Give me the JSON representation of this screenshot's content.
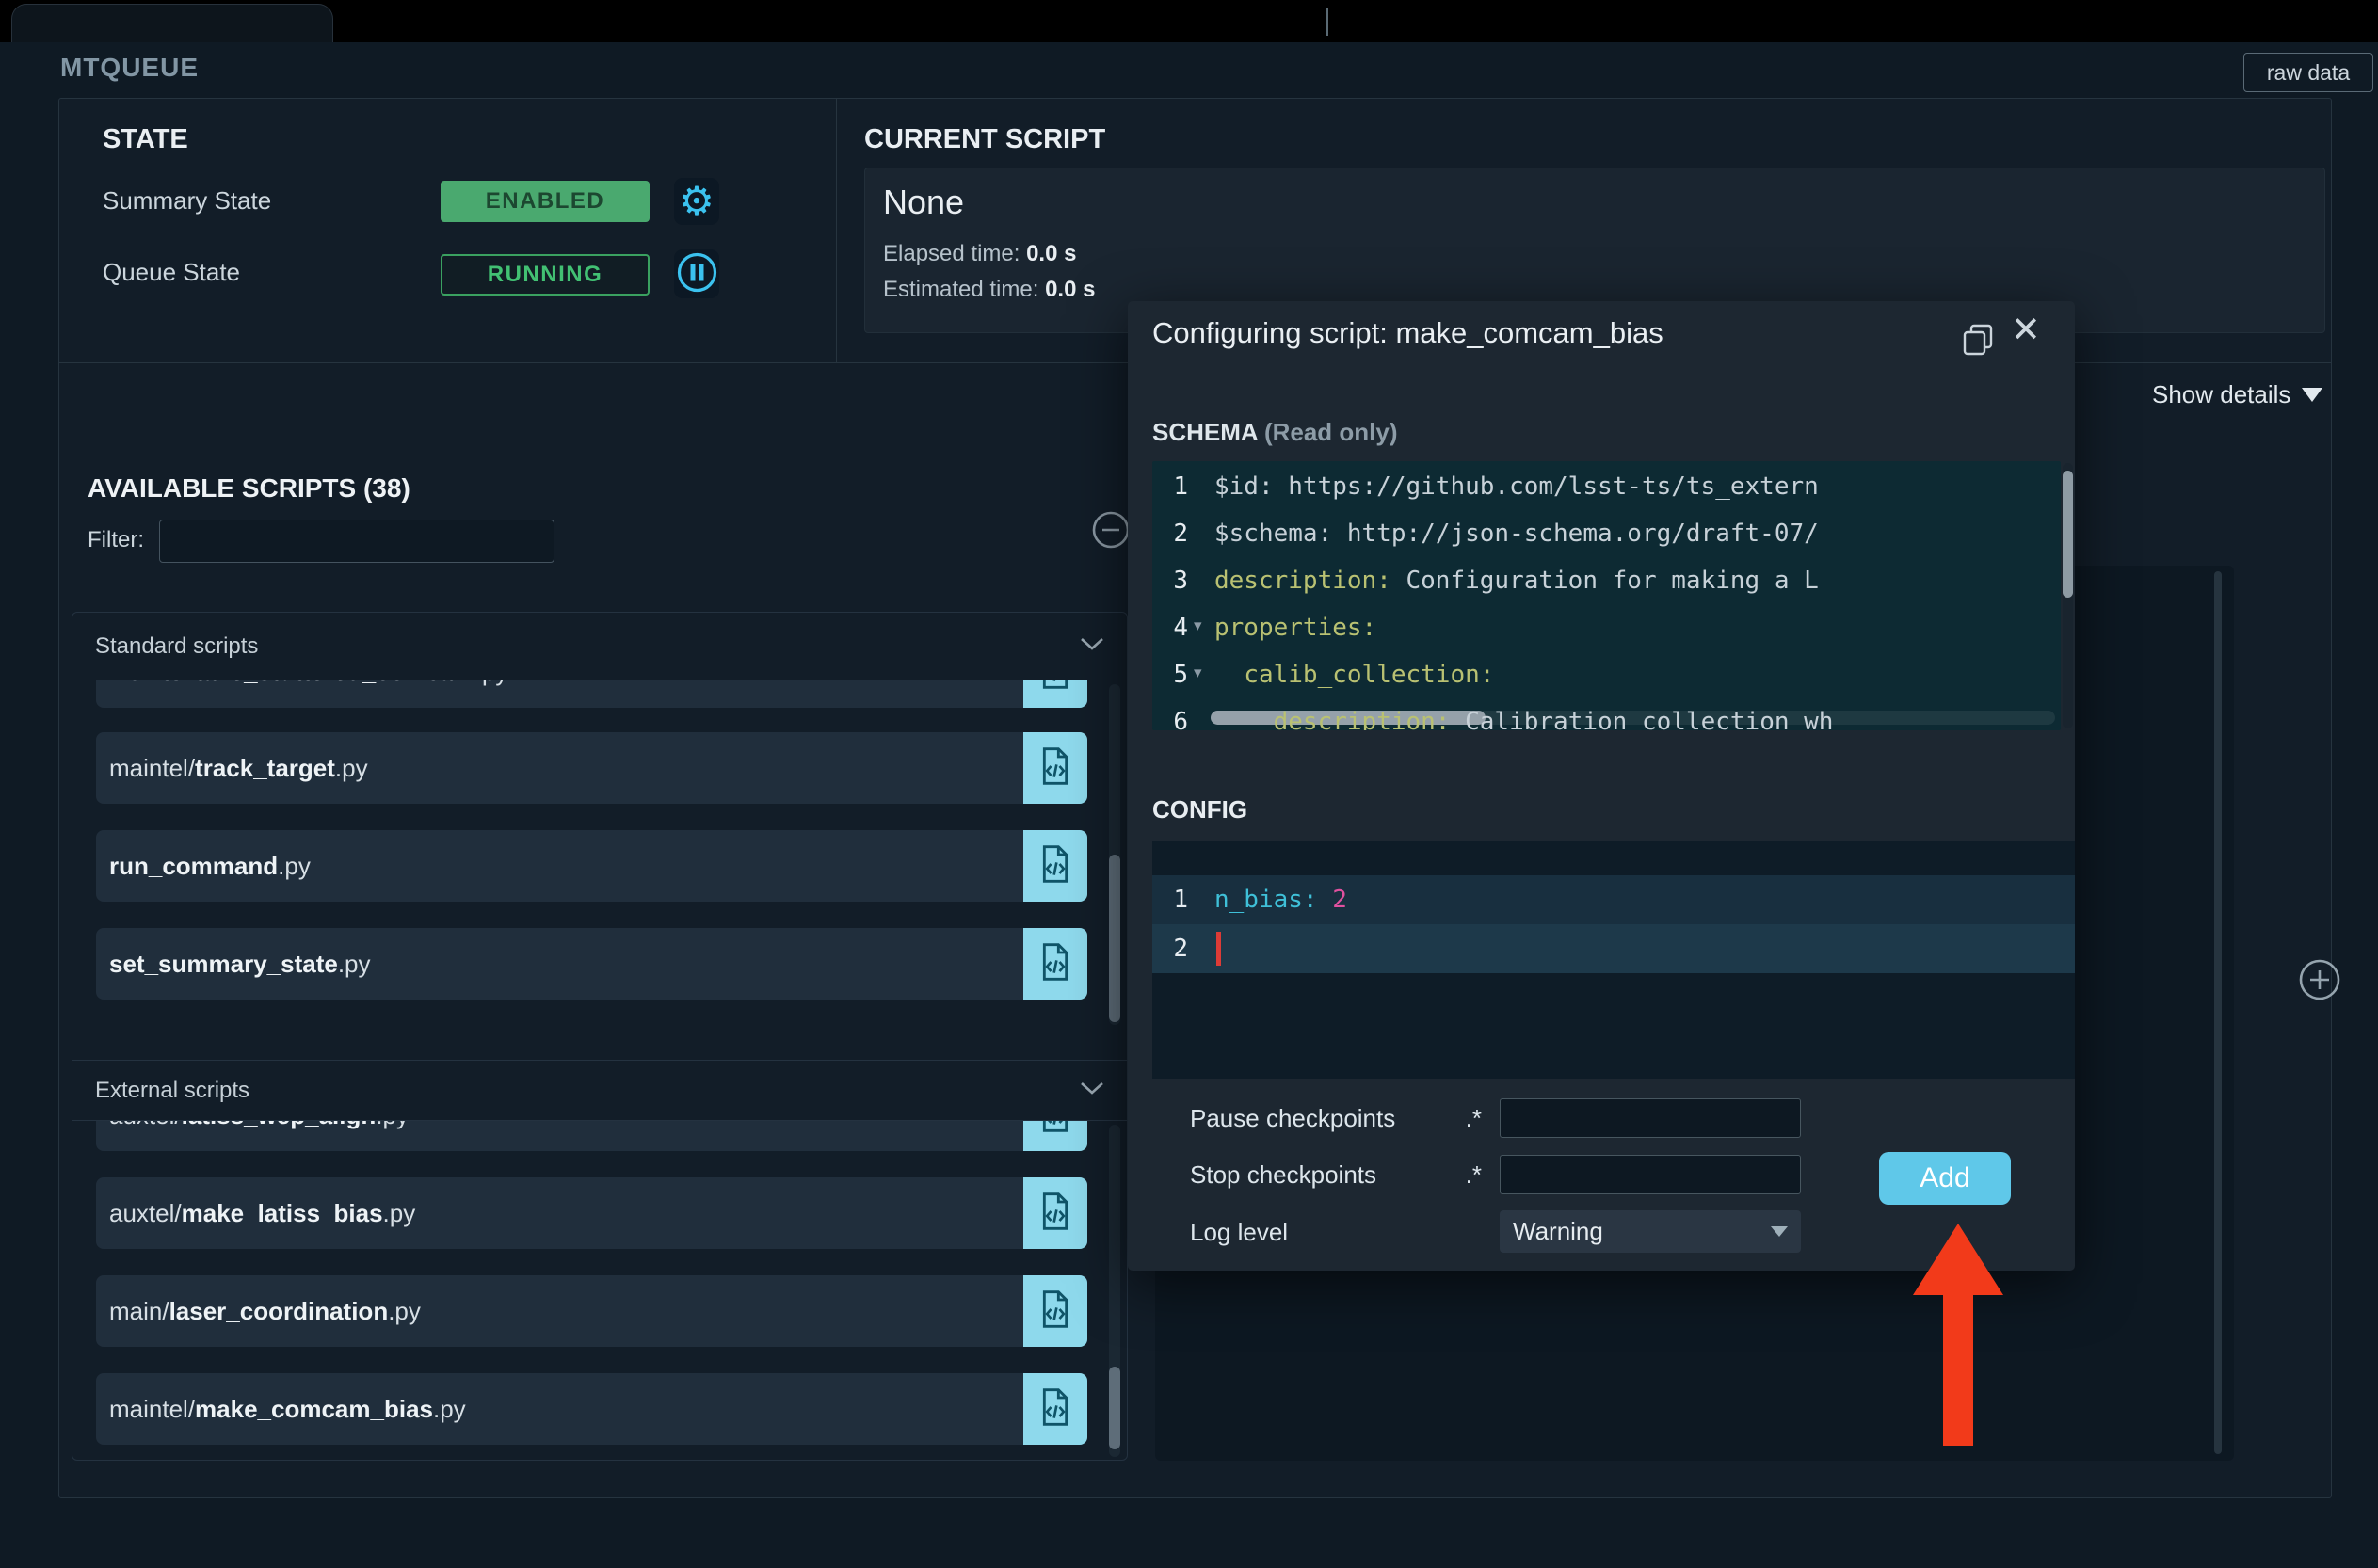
{
  "panel": {
    "title": "MTQUEUE",
    "raw_data_button": "raw data"
  },
  "state": {
    "title": "STATE",
    "summary_state_label": "Summary State",
    "summary_state_value": "ENABLED",
    "queue_state_label": "Queue State",
    "queue_state_value": "RUNNING"
  },
  "current_script": {
    "title": "CURRENT SCRIPT",
    "name": "None",
    "elapsed_label": "Elapsed time:",
    "elapsed_value": "0.0 s",
    "estimated_label": "Estimated time:",
    "estimated_value": "0.0 s"
  },
  "show_details_label": "Show details",
  "available_scripts": {
    "title": "AVAILABLE SCRIPTS (38)",
    "filter_label": "Filter:",
    "filter_value": "",
    "groups": [
      {
        "label": "Standard scripts",
        "items": [
          {
            "prefix": "maintel/",
            "stem": "take_stuttered_comcam",
            "ext": ".py",
            "partial": true
          },
          {
            "prefix": "maintel/",
            "stem": "track_target",
            "ext": ".py"
          },
          {
            "prefix": "",
            "stem": "run_command",
            "ext": ".py"
          },
          {
            "prefix": "",
            "stem": "set_summary_state",
            "ext": ".py"
          }
        ]
      },
      {
        "label": "External scripts",
        "items": [
          {
            "prefix": "auxtel/",
            "stem": "latiss_wep_align",
            "ext": ".py",
            "partial": true
          },
          {
            "prefix": "auxtel/",
            "stem": "make_latiss_bias",
            "ext": ".py"
          },
          {
            "prefix": "main/",
            "stem": "laser_coordination",
            "ext": ".py"
          },
          {
            "prefix": "maintel/",
            "stem": "make_comcam_bias",
            "ext": ".py"
          }
        ]
      }
    ]
  },
  "modal": {
    "title": "Configuring script: make_comcam_bias",
    "schema_label": "SCHEMA",
    "schema_readonly": "(Read only)",
    "schema_lines": [
      {
        "num": "1",
        "tokens": [
          {
            "t": "plain",
            "v": "$id: https://github.com/lsst-ts/ts_extern"
          }
        ]
      },
      {
        "num": "2",
        "tokens": [
          {
            "t": "plain",
            "v": "$schema: http://json-schema.org/draft-07/"
          }
        ]
      },
      {
        "num": "3",
        "tokens": [
          {
            "t": "key",
            "v": "description:"
          },
          {
            "t": "plain",
            "v": " Configuration for making a L"
          }
        ]
      },
      {
        "num": "4",
        "fold": true,
        "tokens": [
          {
            "t": "key",
            "v": "properties:"
          }
        ]
      },
      {
        "num": "5",
        "fold": true,
        "tokens": [
          {
            "t": "plain",
            "v": "  "
          },
          {
            "t": "key",
            "v": "calib_collection:"
          }
        ]
      },
      {
        "num": "6",
        "tokens": [
          {
            "t": "plain",
            "v": "    "
          },
          {
            "t": "key",
            "v": "description:"
          },
          {
            "t": "plain",
            "v": " Calibration collection wh"
          }
        ]
      }
    ],
    "config_label": "CONFIG",
    "config_lines": [
      {
        "num": "1",
        "tokens": [
          {
            "t": "ckey",
            "v": "n_bias:"
          },
          {
            "t": "plain",
            "v": " "
          },
          {
            "t": "cval",
            "v": "2"
          }
        ]
      },
      {
        "num": "2",
        "cursor": true,
        "tokens": []
      }
    ],
    "pause_checkpoints_label": "Pause checkpoints",
    "pause_checkpoints_suffix": ".*",
    "pause_checkpoints_value": "",
    "stop_checkpoints_label": "Stop checkpoints",
    "stop_checkpoints_suffix": ".*",
    "stop_checkpoints_value": "",
    "log_level_label": "Log level",
    "log_level_value": "Warning",
    "add_button": "Add"
  },
  "colors": {
    "enabled_badge": "#4aa96f",
    "running_text": "#42c173",
    "accent_cyan": "#3bc2ef",
    "script_icon": "#8ed9ec",
    "add_button": "#5fc8e9",
    "arrow_red": "#f23a1a",
    "yaml_key": "#b9c172",
    "config_key": "#3fc0d8",
    "config_value": "#e0519f"
  }
}
